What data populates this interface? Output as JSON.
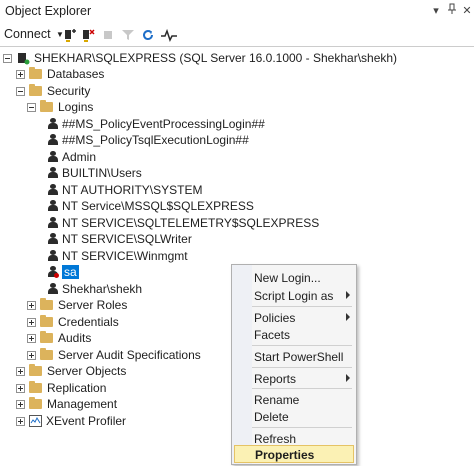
{
  "window": {
    "title": "Object Explorer",
    "controls": [
      "pin-icon",
      "auto-hide-icon",
      "close-icon"
    ]
  },
  "toolbar": {
    "connect_label": "Connect",
    "icons": [
      "connect-object-explorer-icon",
      "disconnect-icon",
      "stop-icon",
      "filter-icon",
      "refresh-icon",
      "activity-monitor-icon"
    ]
  },
  "tree": {
    "server": "SHEKHAR\\SQLEXPRESS (SQL Server 16.0.1000 - Shekhar\\shekh)",
    "databases": "Databases",
    "security": "Security",
    "logins": "Logins",
    "login_items": [
      "##MS_PolicyEventProcessingLogin##",
      "##MS_PolicyTsqlExecutionLogin##",
      "Admin",
      "BUILTIN\\Users",
      "NT AUTHORITY\\SYSTEM",
      "NT Service\\MSSQL$SQLEXPRESS",
      "NT SERVICE\\SQLTELEMETRY$SQLEXPRESS",
      "NT SERVICE\\SQLWriter",
      "NT SERVICE\\Winmgmt",
      "sa",
      "Shekhar\\shekh"
    ],
    "server_roles": "Server Roles",
    "credentials": "Credentials",
    "audits": "Audits",
    "server_audit_specs": "Server Audit Specifications",
    "server_objects": "Server Objects",
    "replication": "Replication",
    "management": "Management",
    "xevent_profiler": "XEvent Profiler"
  },
  "context_menu": {
    "new_login": "New Login...",
    "script_login_as": "Script Login as",
    "policies": "Policies",
    "facets": "Facets",
    "start_powershell": "Start PowerShell",
    "reports": "Reports",
    "rename": "Rename",
    "delete": "Delete",
    "refresh": "Refresh",
    "properties": "Properties"
  },
  "colors": {
    "selection": "#0078d7",
    "highlight": "#fbf1b4",
    "folder": "#dcb35c"
  }
}
